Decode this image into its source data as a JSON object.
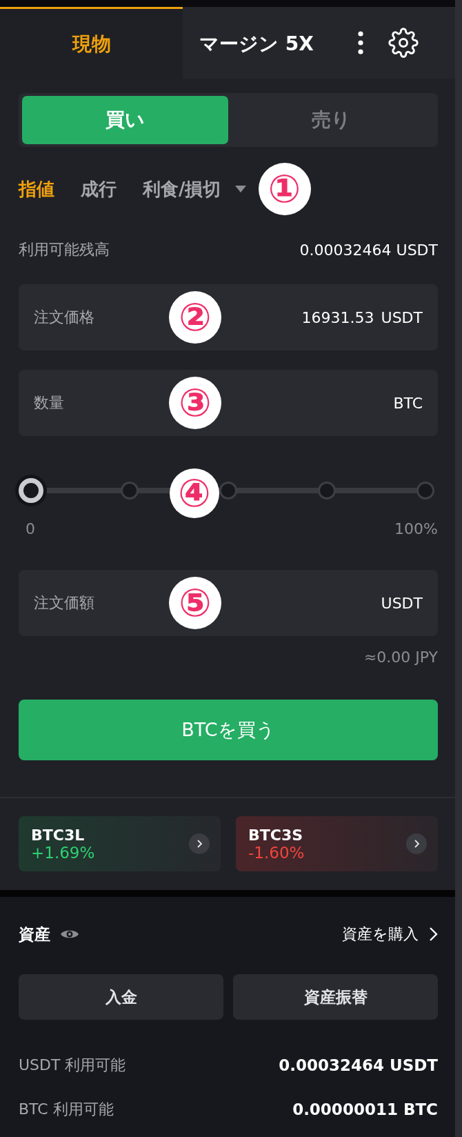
{
  "top_tabs": [
    {
      "label": "現物",
      "selected": true
    },
    {
      "label": "マージン 5X",
      "selected": false
    }
  ],
  "side_toggle": [
    {
      "label": "買い",
      "selected": true
    },
    {
      "label": "売り",
      "selected": false
    }
  ],
  "order_types": [
    {
      "label": "指値",
      "selected": true,
      "dropdown": false
    },
    {
      "label": "成行",
      "selected": false,
      "dropdown": false
    },
    {
      "label": "利食/損切",
      "selected": false,
      "dropdown": true
    }
  ],
  "order_types_marker": "①",
  "available_balance": {
    "label": "利用可能残高",
    "value": "0.00032464 USDT"
  },
  "price_field": {
    "label": "注文価格",
    "value": "16931.53",
    "unit": "USDT",
    "marker": "②"
  },
  "quantity_field": {
    "label": "数量",
    "unit": "BTC",
    "marker": "③"
  },
  "slider": {
    "level": 0,
    "min_label": "0",
    "max_label": "100%",
    "marker": "④"
  },
  "amount_field": {
    "label": "注文価額",
    "unit": "USDT",
    "marker": "⑤"
  },
  "conversion": "≈0.00 JPY",
  "submit_button": "BTCを買う",
  "leveraged_tokens": [
    {
      "symbol": "BTC3L",
      "change": "+1.69%",
      "kind": "up"
    },
    {
      "symbol": "BTC3S",
      "change": "-1.60%",
      "kind": "down"
    }
  ],
  "assets": {
    "title": "資産",
    "buy_link": "資産を購入",
    "buttons": [
      "入金",
      "資産振替"
    ],
    "rows": [
      {
        "label": "USDT 利用可能",
        "value": "0.00032464 USDT"
      },
      {
        "label": "BTC 利用可能",
        "value": "0.00000011 BTC"
      }
    ]
  }
}
